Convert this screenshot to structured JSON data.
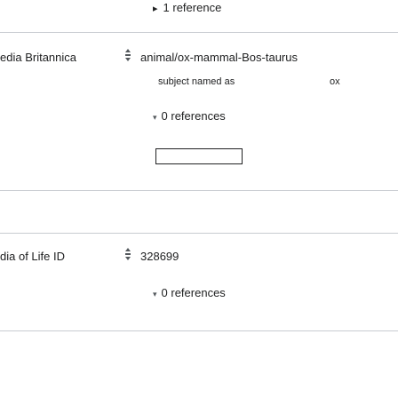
{
  "top_reference": {
    "toggle": "▸",
    "label": "1 reference"
  },
  "statements": [
    {
      "property_label": "edia Britannica",
      "value": "animal/ox-mammal-Bos-taurus",
      "qualifier": {
        "property": "subject named as",
        "value": "ox"
      },
      "references": {
        "toggle": "▾",
        "label": "0 references"
      }
    },
    {
      "property_label": "dia of Life ID",
      "value": "328699",
      "references": {
        "toggle": "▾",
        "label": "0 references"
      }
    }
  ],
  "colors": {
    "divider": "#c8ccd1",
    "text": "#202122",
    "icon": "#54595d"
  },
  "icons": {
    "rank": "normal-rank-icon"
  }
}
